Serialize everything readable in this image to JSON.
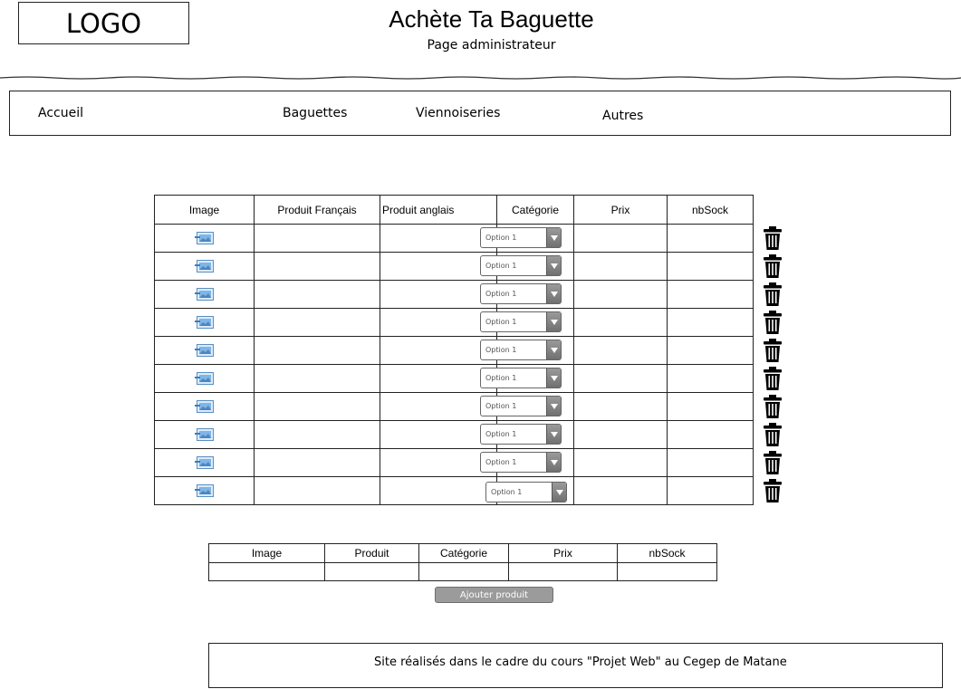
{
  "header": {
    "logo": "LOGO",
    "title": "Achète Ta Baguette",
    "subtitle": "Page administrateur"
  },
  "nav": {
    "items": [
      {
        "label": "Accueil"
      },
      {
        "label": "Baguettes"
      },
      {
        "label": "Viennoiseries"
      },
      {
        "label": "Autres"
      }
    ]
  },
  "products_table": {
    "headers": [
      "Image",
      "Produit Français",
      "Produit anglais",
      "Catégorie",
      "Prix",
      "nbSock"
    ],
    "rows": [
      {
        "categorie": "Option 1"
      },
      {
        "categorie": "Option 1"
      },
      {
        "categorie": "Option 1"
      },
      {
        "categorie": "Option 1"
      },
      {
        "categorie": "Option 1"
      },
      {
        "categorie": "Option 1"
      },
      {
        "categorie": "Option 1"
      },
      {
        "categorie": "Option 1"
      },
      {
        "categorie": "Option 1"
      },
      {
        "categorie": "Option 1"
      }
    ],
    "row_icons": {
      "image": "image-placeholder-icon",
      "delete": "trash-icon"
    }
  },
  "add_table": {
    "headers": [
      "Image",
      "Produit",
      "Catégorie",
      "Prix",
      "nbSock"
    ]
  },
  "add_button": {
    "label": "Ajouter produit"
  },
  "footer": {
    "text": "Site réalisés dans le cadre du cours \"Projet Web\" au Cegep de Matane"
  }
}
